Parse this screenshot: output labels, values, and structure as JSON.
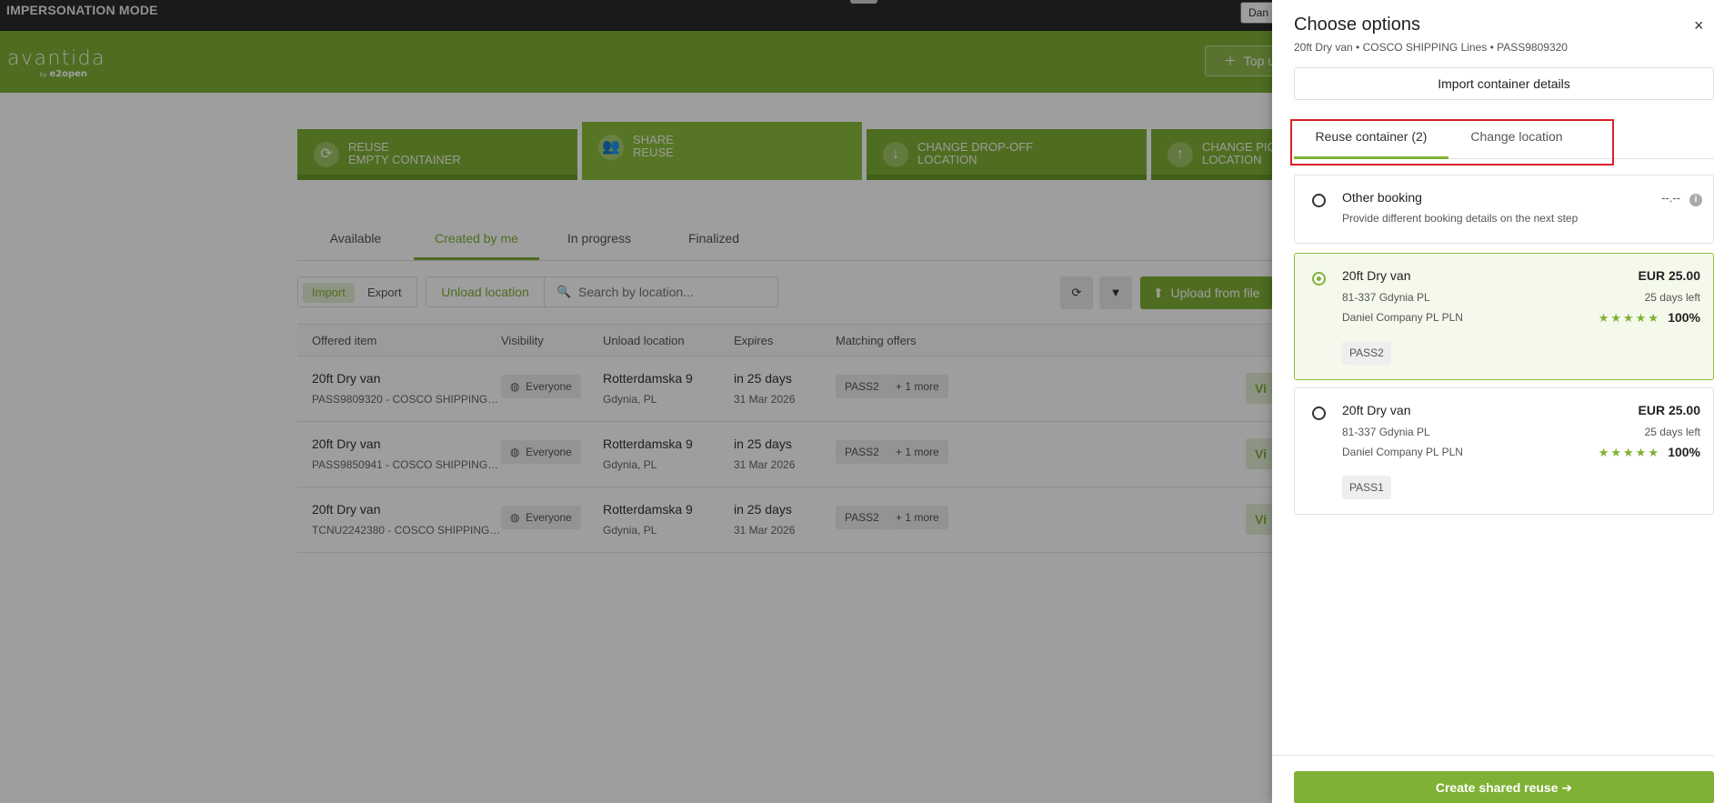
{
  "topbar": {
    "mode": "IMPERSONATION MODE",
    "user": "Dan"
  },
  "header": {
    "logo": "avantida",
    "logo_sub_by": "by",
    "logo_sub": "e2open",
    "topup_label": "Top u"
  },
  "cards": [
    {
      "line1": "REUSE",
      "line2": "EMPTY CONTAINER",
      "icon": "recycle-icon"
    },
    {
      "line1": "SHARE",
      "line2": "REUSE",
      "icon": "people-icon"
    },
    {
      "line1": "CHANGE DROP-OFF",
      "line2": "LOCATION",
      "icon": "arrow-down-icon"
    },
    {
      "line1": "CHANGE PIC",
      "line2": "LOCATION",
      "icon": "arrow-up-icon"
    }
  ],
  "tabs": [
    "Available",
    "Created by me",
    "In progress",
    "Finalized"
  ],
  "toolbar": {
    "import": "Import",
    "export": "Export",
    "unload_location": "Unload location",
    "search_placeholder": "Search by location...",
    "upload": "Upload from file"
  },
  "table": {
    "headers": [
      "Offered item",
      "Visibility",
      "Unload location",
      "Expires",
      "Matching offers"
    ],
    "rows": [
      {
        "item": "20ft Dry van",
        "sub": "PASS9809320 - COSCO SHIPPING…",
        "visibility": "Everyone",
        "loc": "Rotterdamska 9",
        "loc_sub": "Gdynia, PL",
        "expires": "in 25 days",
        "expires_sub": "31 Mar 2026",
        "offer": "PASS2",
        "more": "+ 1 more",
        "view": "Vi"
      },
      {
        "item": "20ft Dry van",
        "sub": "PASS9850941 - COSCO SHIPPING…",
        "visibility": "Everyone",
        "loc": "Rotterdamska 9",
        "loc_sub": "Gdynia, PL",
        "expires": "in 25 days",
        "expires_sub": "31 Mar 2026",
        "offer": "PASS2",
        "more": "+ 1 more",
        "view": "Vi"
      },
      {
        "item": "20ft Dry van",
        "sub": "TCNU2242380 - COSCO SHIPPING…",
        "visibility": "Everyone",
        "loc": "Rotterdamska 9",
        "loc_sub": "Gdynia, PL",
        "expires": "in 25 days",
        "expires_sub": "31 Mar 2026",
        "offer": "PASS2",
        "more": "+ 1 more",
        "view": "Vi"
      }
    ]
  },
  "panel": {
    "title": "Choose options",
    "subtitle": "20ft Dry van  •  COSCO SHIPPING Lines  •  PASS9809320",
    "close": "×",
    "import_details": "Import container details",
    "tabs": [
      "Reuse container (2)",
      "Change location"
    ],
    "other": {
      "title": "Other booking",
      "desc": "Provide different booking details on the next step",
      "price": "--.--"
    },
    "options": [
      {
        "title": "20ft Dry van",
        "addr": "81-337 Gdynia PL",
        "company": "Daniel Company PL PLN",
        "price": "EUR 25.00",
        "days": "25 days left",
        "stars": "★★★★★",
        "rating": "100%",
        "tag": "PASS2",
        "selected": true
      },
      {
        "title": "20ft Dry van",
        "addr": "81-337 Gdynia PL",
        "company": "Daniel Company PL PLN",
        "price": "EUR 25.00",
        "days": "25 days left",
        "stars": "★★★★★",
        "rating": "100%",
        "tag": "PASS1",
        "selected": false
      }
    ],
    "create": "Create shared reuse  ➔"
  }
}
